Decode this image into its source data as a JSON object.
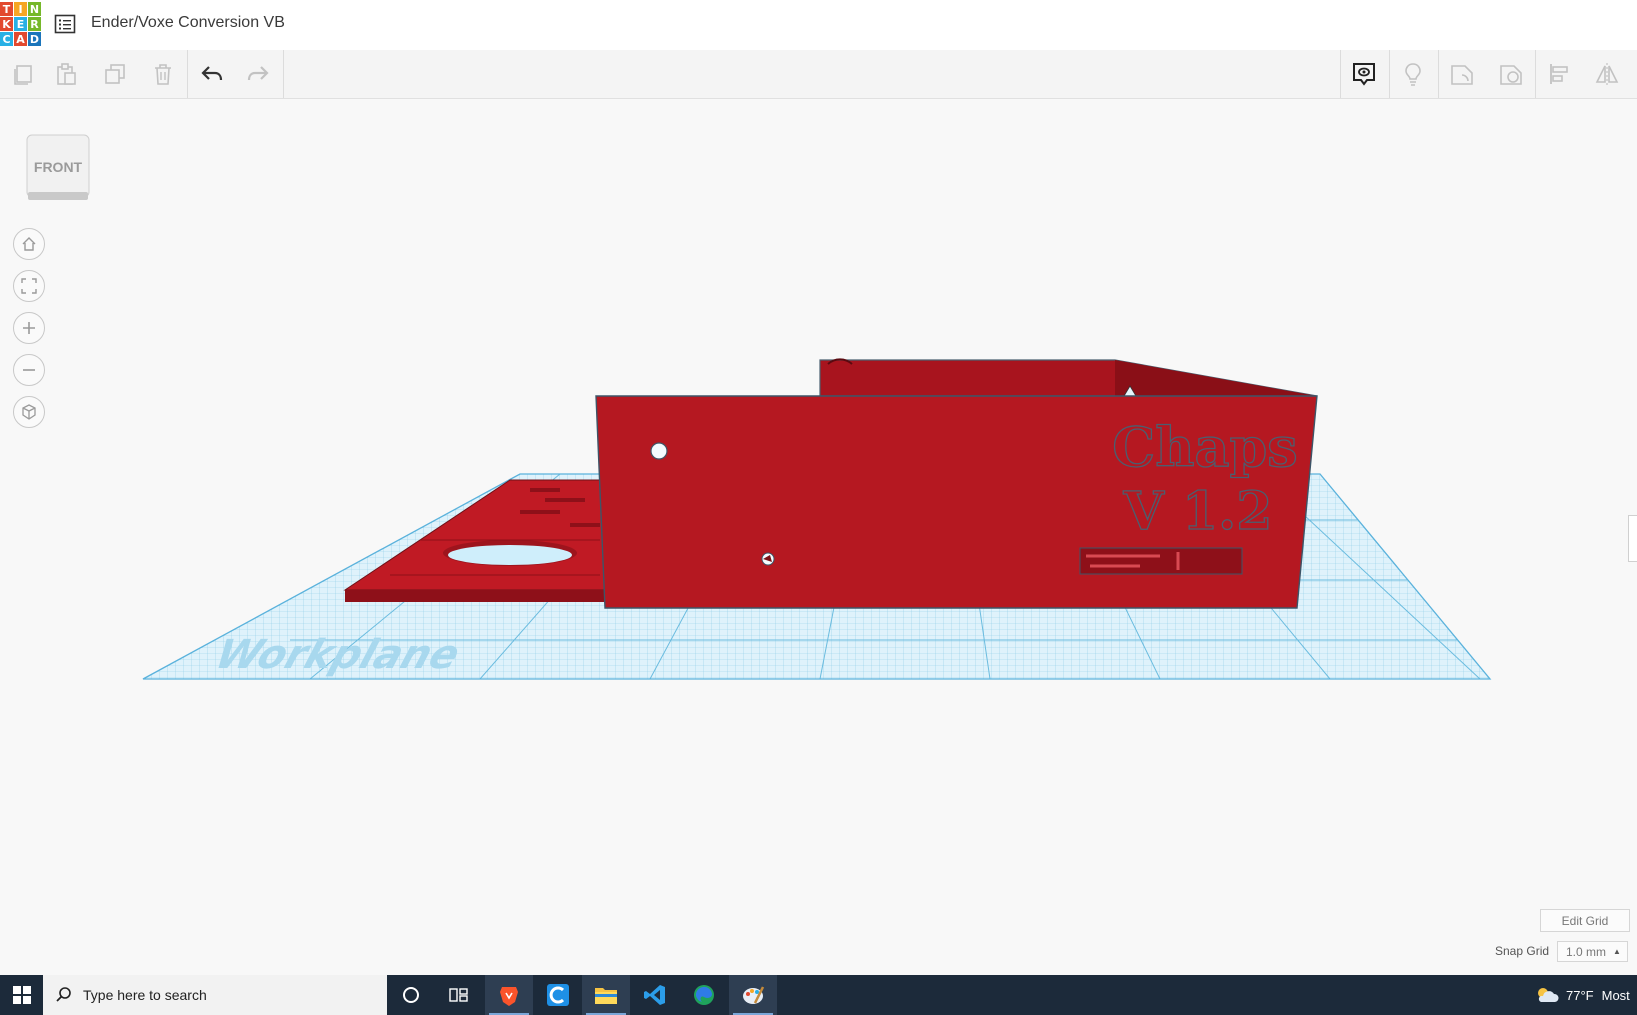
{
  "app": {
    "logo_letters": [
      "T",
      "I",
      "N",
      "K",
      "E",
      "R",
      "C",
      "A",
      "D"
    ],
    "logo_colors": [
      "#e2492f",
      "#f6a623",
      "#76b82a",
      "#e2492f",
      "#28b0e5",
      "#76b82a",
      "#28b0e5",
      "#e2492f",
      "#1b75bb"
    ],
    "document_title": "Ender/Voxe Conversion VB"
  },
  "viewport": {
    "viewcube_label": "FRONT",
    "workplane_label": "Workplane",
    "model_text_line1": "Chaps",
    "model_text_line2": "V 1.2",
    "model_color": "#b01822",
    "grid_color": "#9fd7ee"
  },
  "grid_controls": {
    "edit_grid_label": "Edit Grid",
    "snap_grid_label": "Snap Grid",
    "snap_grid_value": "1.0 mm"
  },
  "taskbar": {
    "search_placeholder": "Type here to search",
    "weather_temp": "77°F",
    "weather_desc": "Most"
  }
}
